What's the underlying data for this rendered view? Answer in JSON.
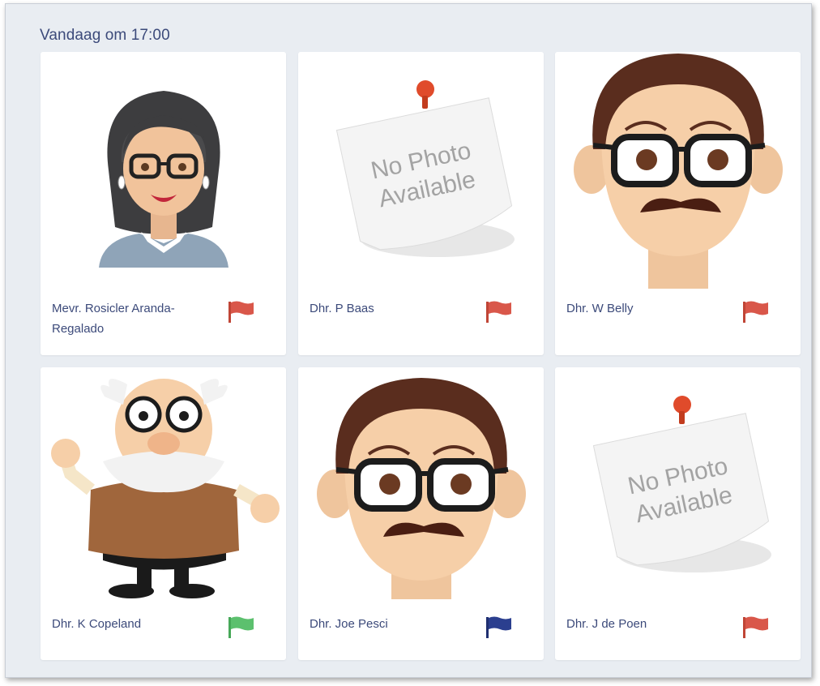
{
  "section": {
    "title": "Vandaag om 17:00"
  },
  "placeholder": {
    "line1": "No Photo",
    "line2": "Available"
  },
  "colors": {
    "flag_red": "#d9574a",
    "flag_green": "#5cc06e",
    "flag_blue": "#2b3f8f",
    "text": "#3c4a7a"
  },
  "people": [
    {
      "name": "Mevr. Rosicler Aranda-Regalado",
      "photo": "woman-avatar",
      "flag": "red-flag-icon"
    },
    {
      "name": "Dhr. P Baas",
      "photo": "no-photo-placeholder",
      "flag": "red-flag-icon"
    },
    {
      "name": "Dhr. W Belly",
      "photo": "man-mustache-avatar",
      "flag": "red-flag-icon"
    },
    {
      "name": "Dhr. K Copeland",
      "photo": "old-man-avatar",
      "flag": "green-flag-icon"
    },
    {
      "name": "Dhr. Joe Pesci",
      "photo": "man-mustache-avatar",
      "flag": "blue-flag-icon"
    },
    {
      "name": "Dhr. J de Poen",
      "photo": "no-photo-placeholder",
      "flag": "red-flag-icon"
    }
  ]
}
